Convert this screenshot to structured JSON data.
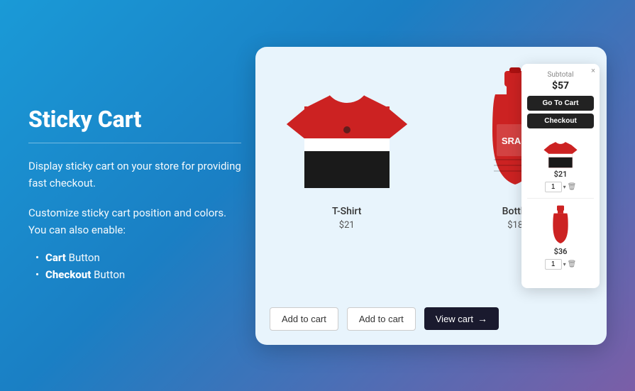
{
  "left": {
    "title": "Sticky Cart",
    "divider": true,
    "description1": "Display sticky cart on your store for providing fast checkout.",
    "description2": "Customize sticky cart position and colors. You can also enable:",
    "list": [
      {
        "bold": "Cart",
        "text": " Button"
      },
      {
        "bold": "Checkout",
        "text": " Button"
      }
    ]
  },
  "right": {
    "products": [
      {
        "name": "T-Shirt",
        "price": "$21",
        "addToCartLabel": "Add to cart"
      },
      {
        "name": "Bottle",
        "price": "$18",
        "addToCartLabel": "Add to cart"
      }
    ],
    "viewCartLabel": "View cart",
    "viewCartArrow": "→"
  },
  "stickyCart": {
    "closeLabel": "×",
    "subtotalLabel": "Subtotal",
    "subtotalValue": "$57",
    "goToCartLabel": "Go To Cart",
    "checkoutLabel": "Checkout",
    "items": [
      {
        "price": "$21",
        "qty": "1"
      },
      {
        "price": "$36",
        "qty": "1"
      }
    ]
  },
  "colors": {
    "background_from": "#1a9ad7",
    "background_to": "#7b5ea7",
    "button_dark": "#1a1a2e",
    "accent": "#d63030"
  }
}
